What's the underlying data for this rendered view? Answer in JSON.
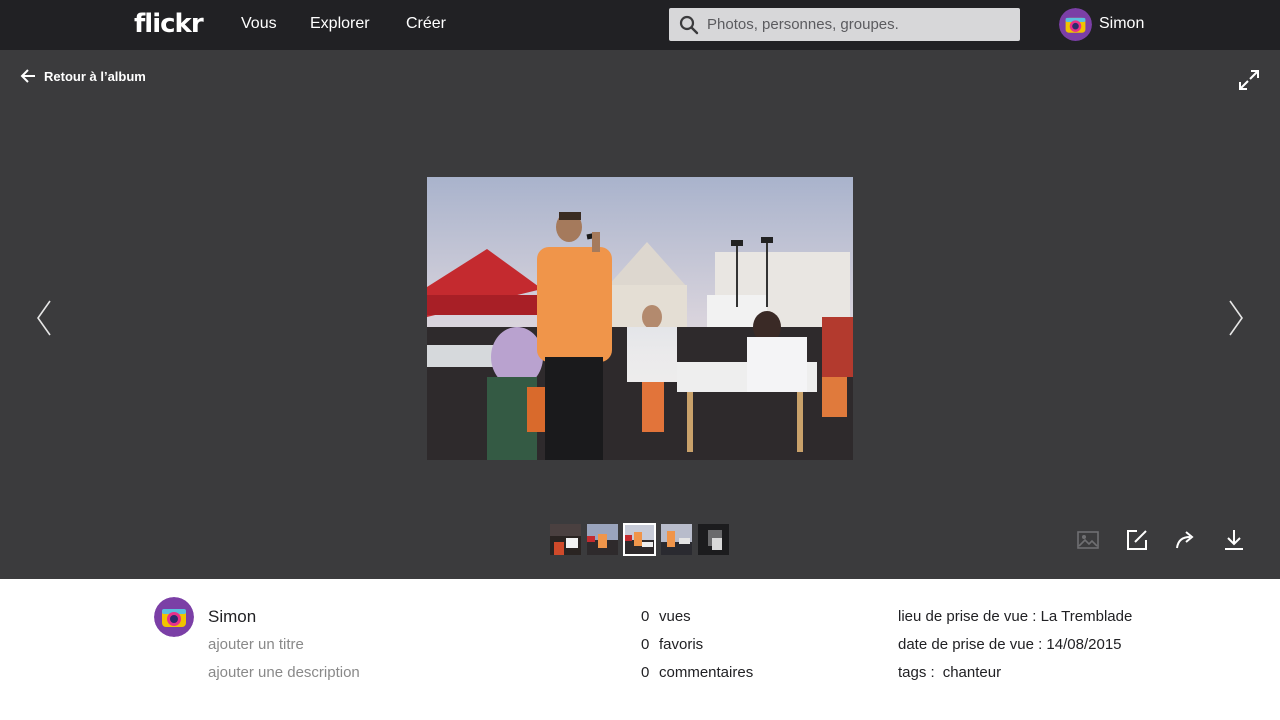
{
  "nav": {
    "logo": "flickr",
    "items": [
      "Vous",
      "Explorer",
      "Créer"
    ],
    "search_placeholder": "Photos, personnes, groupes.",
    "user": "Simon"
  },
  "viewer": {
    "back_label": "Retour à l’album",
    "thumbnail_count": 5,
    "active_thumbnail": 3
  },
  "info": {
    "owner": "Simon",
    "add_title": "ajouter un titre",
    "add_description": "ajouter une description",
    "stats": [
      {
        "value": "0",
        "label": "vues"
      },
      {
        "value": "0",
        "label": "favoris"
      },
      {
        "value": "0",
        "label": "commentaires"
      }
    ],
    "location": "lieu de prise de vue : La Tremblade",
    "date_taken": "date de prise de vue : 14/08/2015",
    "tags_label": "tags :",
    "tags": [
      "chanteur"
    ]
  },
  "colors": {
    "topbar": "#212124",
    "viewer_bg": "#3b3b3d",
    "muted_text": "#898989"
  }
}
